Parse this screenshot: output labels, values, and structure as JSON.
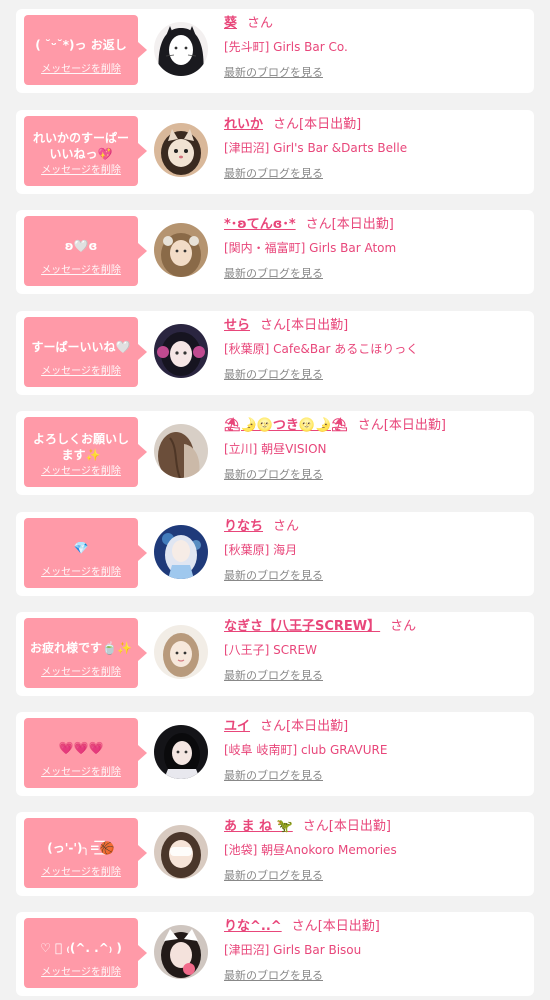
{
  "entries": [
    {
      "message": "( ˘ᵕ˘*)っ お返し",
      "delete_label": "メッセージを削除",
      "name": "葵",
      "san": "さん",
      "status": "",
      "shop": "[先斗町] Girls Bar Co.",
      "blog_label": "最新のブログを見る",
      "avatar": "avatar-photo"
    },
    {
      "message": "れいかのすーぱーいいねっ💖",
      "delete_label": "メッセージを削除",
      "name": "れいか",
      "san": "さん",
      "status": "[本日出勤]",
      "shop": "[津田沼] Girl's Bar &Darts Belle",
      "blog_label": "最新のブログを見る",
      "avatar": "avatar-photo"
    },
    {
      "message": "ʚ🤍ɞ",
      "delete_label": "メッセージを削除",
      "name": "*･ʚてんɞ･*",
      "san": "さん",
      "status": "[本日出勤]",
      "shop": "[関内・福富町] Girls Bar Atom",
      "blog_label": "最新のブログを見る",
      "avatar": "avatar-photo"
    },
    {
      "message": "すーぱーいいね🤍",
      "delete_label": "メッセージを削除",
      "name": "せら",
      "san": "さん",
      "status": "[本日出勤]",
      "shop": "[秋葉原] Cafe&Bar あるこほりっく",
      "blog_label": "最新のブログを見る",
      "avatar": "avatar-photo"
    },
    {
      "message": "よろしくお願いします✨",
      "delete_label": "メッセージを削除",
      "name": "⛱🌛🌝つき🌝🌛⛱",
      "san": "さん",
      "status": "[本日出勤]",
      "shop": "[立川] 朝昼VISION",
      "blog_label": "最新のブログを見る",
      "avatar": "avatar-photo"
    },
    {
      "message": "💎",
      "delete_label": "メッセージを削除",
      "name": "りなち",
      "san": "さん",
      "status": "",
      "shop": "[秋葉原] 海月",
      "blog_label": "最新のブログを見る",
      "avatar": "avatar-photo"
    },
    {
      "message": "お疲れ様です🍵✨",
      "delete_label": "メッセージを削除",
      "name": "なぎさ【八王子SCREW】",
      "san": "さん",
      "status": "",
      "shop": "[八王子] SCREW",
      "blog_label": "最新のブログを見る",
      "avatar": "avatar-photo"
    },
    {
      "message": "💗💗💗",
      "delete_label": "メッセージを削除",
      "name": "ユイ",
      "san": "さん",
      "status": "[本日出勤]",
      "shop": "[岐阜 岐南町] club GRAVURE",
      "blog_label": "最新のブログを見る",
      "avatar": "avatar-photo"
    },
    {
      "message": "(っ'-')╮=͟͟͞͞🏀",
      "delete_label": "メッセージを削除",
      "name": "あ ま ね 🦖",
      "san": "さん",
      "status": "[本日出勤]",
      "shop": "[池袋] 朝昼Anokoro Memories",
      "blog_label": "最新のブログを見る",
      "avatar": "avatar-photo"
    },
    {
      "message": "♡ ﾟ ₍(^. .^₎ )",
      "delete_label": "メッセージを削除",
      "name": "りな^..^",
      "san": "さん",
      "status": "[本日出勤]",
      "shop": "[津田沼] Girls Bar Bisou",
      "blog_label": "最新のブログを見る",
      "avatar": "avatar-photo"
    }
  ],
  "colors": {
    "page_background": "#f2f2f2",
    "card_background": "#ffffff",
    "bubble": "#ff9aa8",
    "name": "#e8467a",
    "blog_link": "#888888"
  }
}
